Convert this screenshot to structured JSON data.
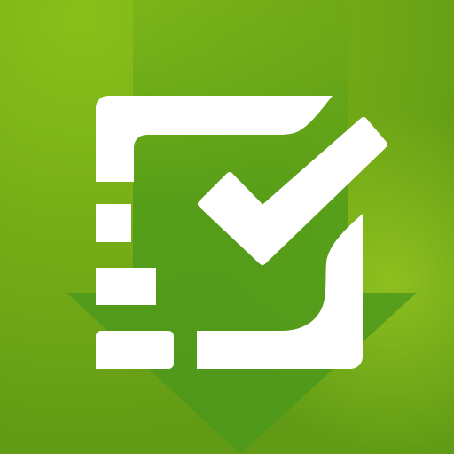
{
  "icon": {
    "name": "checklist-app-icon",
    "colors": {
      "background_light": "#8cc11a",
      "background_mid": "#6ea516",
      "background_dark": "#5f9915",
      "arrow_shadow": "#4f961c",
      "glyph": "#ffffff"
    },
    "glyphs": [
      "checkbox-frame-icon",
      "checkmark-icon",
      "list-lines-icon",
      "down-arrow-shadow-icon"
    ]
  }
}
